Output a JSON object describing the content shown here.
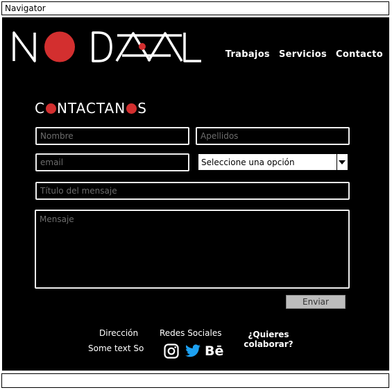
{
  "window": {
    "title": "Navigator"
  },
  "brand": {
    "logo_text": "NODAL",
    "accent": "#d32f2f"
  },
  "nav": {
    "items": [
      "Trabajos",
      "Servicios",
      "Contacto"
    ]
  },
  "contact": {
    "heading_parts": [
      "C",
      "NTACTAN",
      "S"
    ],
    "fields": {
      "nombre": "Nombre",
      "apellidos": "Apellidos",
      "email": "email",
      "select_value": "Seleccione una opción",
      "titulo": "Título del mensaje",
      "mensaje": "Mensaje"
    },
    "submit": "Enviar"
  },
  "footer": {
    "direccion_label": "Dirección",
    "direccion_text": "Some text So",
    "redes_label": "Redes Sociales",
    "social_icons": [
      "instagram-icon",
      "twitter-icon",
      "behance-icon"
    ],
    "behance_text": "Bē",
    "collab": "¿Quieres colaborar?"
  }
}
